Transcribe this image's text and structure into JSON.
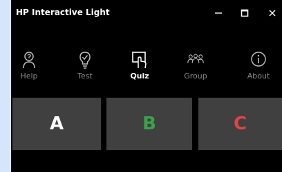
{
  "window": {
    "title": "HP Interactive Light"
  },
  "toolbar": {
    "items": [
      {
        "label": "Help",
        "icon": "help-person-icon"
      },
      {
        "label": "Test",
        "icon": "lightbulb-icon"
      },
      {
        "label": "Quiz",
        "icon": "quiz-touch-icon",
        "active": true
      },
      {
        "label": "Group",
        "icon": "group-icon"
      },
      {
        "label": "About",
        "icon": "info-icon"
      }
    ]
  },
  "answers": [
    {
      "label": "A",
      "color": "#ffffff"
    },
    {
      "label": "B",
      "color": "#3aa34a"
    },
    {
      "label": "C",
      "color": "#e04444"
    }
  ],
  "colors": {
    "background": "#000000",
    "tile": "#404040",
    "inactive_label": "#8a8a8a",
    "active_label": "#ffffff"
  }
}
